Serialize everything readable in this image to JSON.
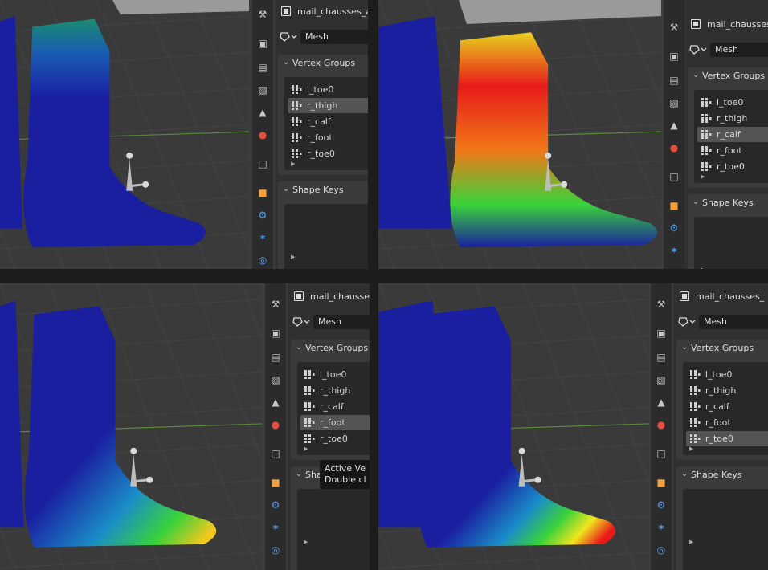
{
  "panels": [
    {
      "object_name": "mail_chausses_a",
      "data_type_label": "Mesh",
      "vertex_groups_header": "Vertex Groups",
      "groups": [
        "l_toe0",
        "r_thigh",
        "r_calf",
        "r_foot",
        "r_toe0"
      ],
      "active_group": "r_thigh",
      "shape_keys_header": "Shape Keys"
    },
    {
      "object_name": "mail_chausses_a",
      "data_type_label": "Mesh",
      "vertex_groups_header": "Vertex Groups",
      "groups": [
        "l_toe0",
        "r_thigh",
        "r_calf",
        "r_foot",
        "r_toe0"
      ],
      "active_group": "r_calf",
      "shape_keys_header": "Shape Keys"
    },
    {
      "object_name": "mail_chausse",
      "data_type_label": "Mesh",
      "vertex_groups_header": "Vertex Groups",
      "groups": [
        "l_toe0",
        "r_thigh",
        "r_calf",
        "r_foot",
        "r_toe0"
      ],
      "active_group": "r_foot",
      "shape_keys_header": "Shape Keys",
      "tooltip": [
        "Active Ve",
        "Double cl"
      ]
    },
    {
      "object_name": "mail_chausses_",
      "data_type_label": "Mesh",
      "vertex_groups_header": "Vertex Groups",
      "groups": [
        "l_toe0",
        "r_thigh",
        "r_calf",
        "r_foot",
        "r_toe0"
      ],
      "active_group": "r_toe0",
      "shape_keys_header": "Shape Keys"
    }
  ],
  "weight_paint_colors": {
    "zero": "#1a1fa0",
    "low": "#1a8cc8",
    "mid": "#3ad23a",
    "high": "#f0e61e",
    "full": "#e81a1a"
  },
  "property_tab_icons": [
    "tool-icon",
    "render-icon",
    "output-icon",
    "view-layer-icon",
    "scene-icon",
    "world-icon",
    "collection-icon",
    "object-icon",
    "modifier-icon",
    "particles-icon",
    "physics-icon"
  ]
}
